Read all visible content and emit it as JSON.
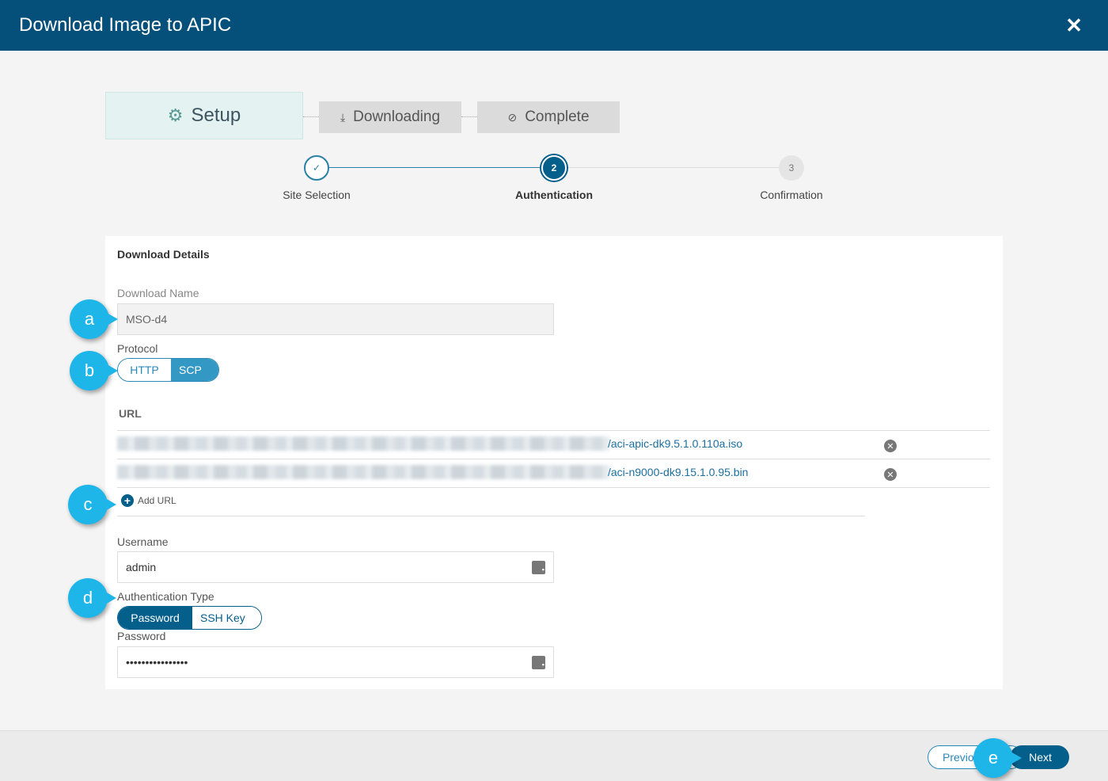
{
  "header": {
    "title": "Download Image to APIC"
  },
  "stages": {
    "setup": "Setup",
    "downloading": "Downloading",
    "complete": "Complete"
  },
  "wizard": {
    "steps": [
      {
        "label": "Site Selection",
        "number": "✓",
        "state": "done"
      },
      {
        "label": "Authentication",
        "number": "2",
        "state": "active"
      },
      {
        "label": "Confirmation",
        "number": "3",
        "state": "todo"
      }
    ]
  },
  "form": {
    "section_title": "Download Details",
    "download_name_label": "Download Name",
    "download_name_value": "MSO-d4",
    "protocol_label": "Protocol",
    "protocol_options": [
      "HTTP",
      "SCP"
    ],
    "protocol_selected": "SCP",
    "url_label": "URL",
    "urls": [
      "/aci-apic-dk9.5.1.0.110a.iso",
      "/aci-n9000-dk9.15.1.0.95.bin"
    ],
    "add_url_label": "Add URL",
    "username_label": "Username",
    "username_value": "admin",
    "auth_type_label": "Authentication Type",
    "auth_type_options": [
      "Password",
      "SSH Key"
    ],
    "auth_type_selected": "Password",
    "password_label": "Password",
    "password_value": "••••••••••••••••"
  },
  "footer": {
    "previous_label": "Previo",
    "next_label": "Next"
  },
  "callouts": [
    "a",
    "b",
    "c",
    "d",
    "e"
  ]
}
